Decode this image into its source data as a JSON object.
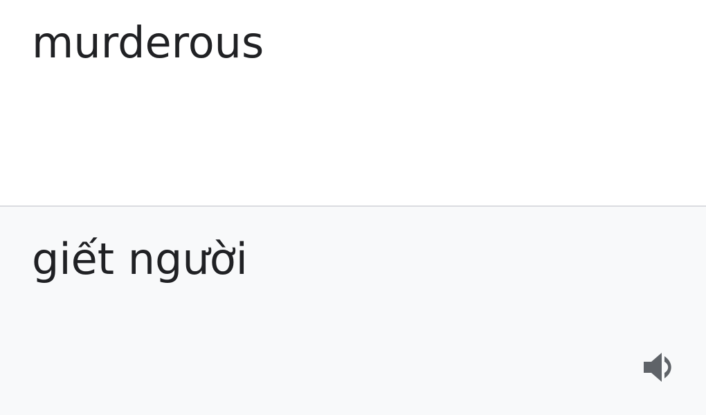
{
  "source": {
    "text": "murderous"
  },
  "translation": {
    "text": "giết người",
    "listen_icon": "volume-up-icon"
  },
  "colors": {
    "text": "#202124",
    "icon": "#5f6368",
    "source_bg": "#ffffff",
    "translation_bg": "#f8f9fa",
    "divider": "#dadce0"
  }
}
